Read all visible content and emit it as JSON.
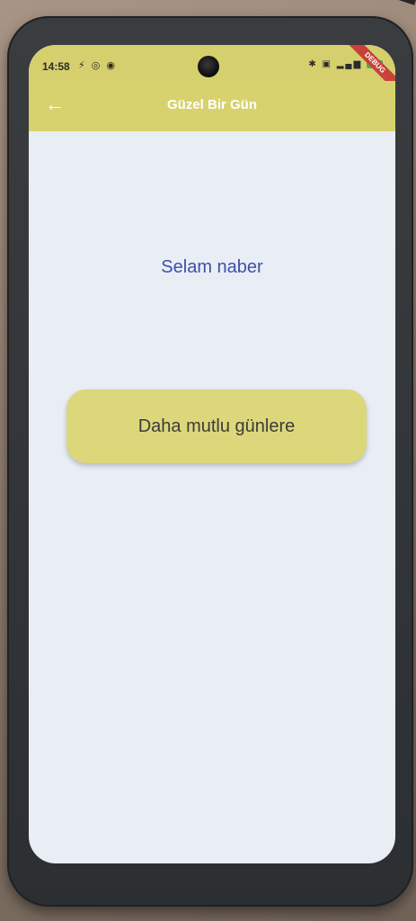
{
  "status_bar": {
    "time": "14:58",
    "left_icons": "⚡ ◎ ◉",
    "right_icons": "✱ ▣ ▂▄▆",
    "debug_label": "DEBUG"
  },
  "app_bar": {
    "title": "Güzel Bir Gün",
    "back_icon": "arrow-back-icon"
  },
  "content": {
    "greeting": "Selam naber",
    "button_label": "Daha mutlu günlere"
  },
  "colors": {
    "app_bar": "#d7d26d",
    "button": "#dcd77a",
    "text_primary": "#3d4fa8",
    "screen_background": "#e9eef4"
  }
}
